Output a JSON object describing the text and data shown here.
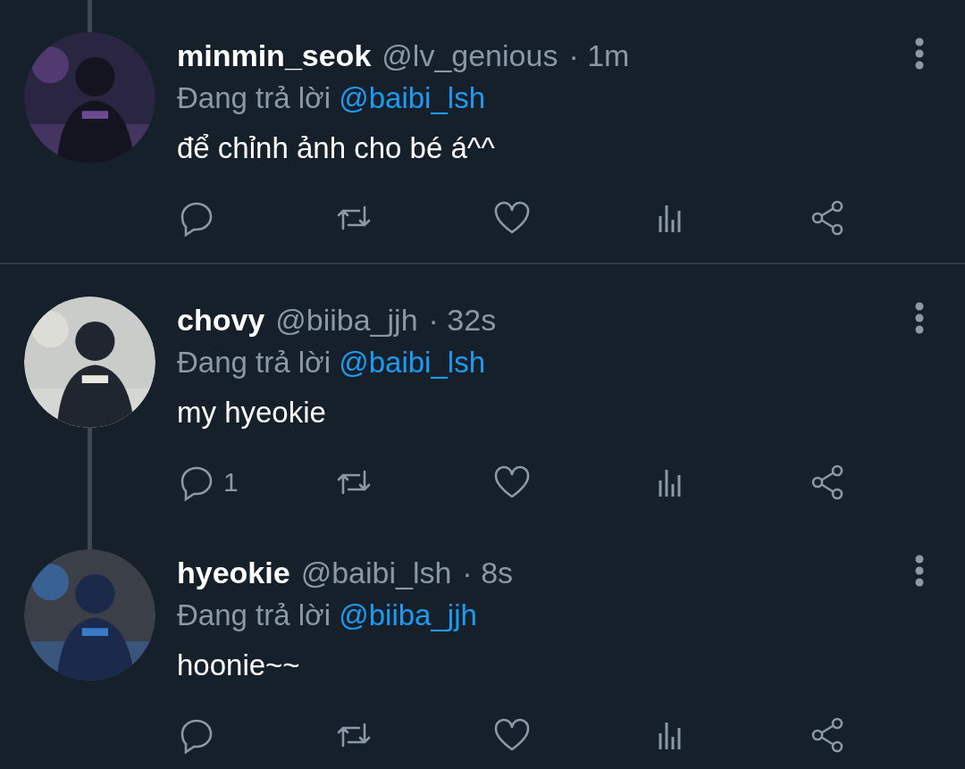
{
  "tweets": [
    {
      "name": "minmin_seok",
      "handle": "@lv_genious",
      "time": "· 1m",
      "reply_prefix": "Đang trả lời",
      "reply_to": "@baibi_lsh",
      "text": "để chỉnh ảnh cho bé á^^",
      "thread_above": true,
      "thread_below": false,
      "divider_below": true
    },
    {
      "name": "chovy",
      "handle": "@biiba_jjh",
      "time": "· 32s",
      "reply_prefix": "Đang trả lời",
      "reply_to": "@baibi_lsh",
      "text": "my hyeokie",
      "reply_count": "1",
      "thread_above": false,
      "thread_below": true,
      "divider_below": false
    },
    {
      "name": "hyeokie",
      "handle": "@baibi_lsh",
      "time": "· 8s",
      "reply_prefix": "Đang trả lời",
      "reply_to": "@biiba_jjh",
      "text": "hoonie~~",
      "thread_above": true,
      "thread_below": false,
      "divider_below": false
    }
  ]
}
